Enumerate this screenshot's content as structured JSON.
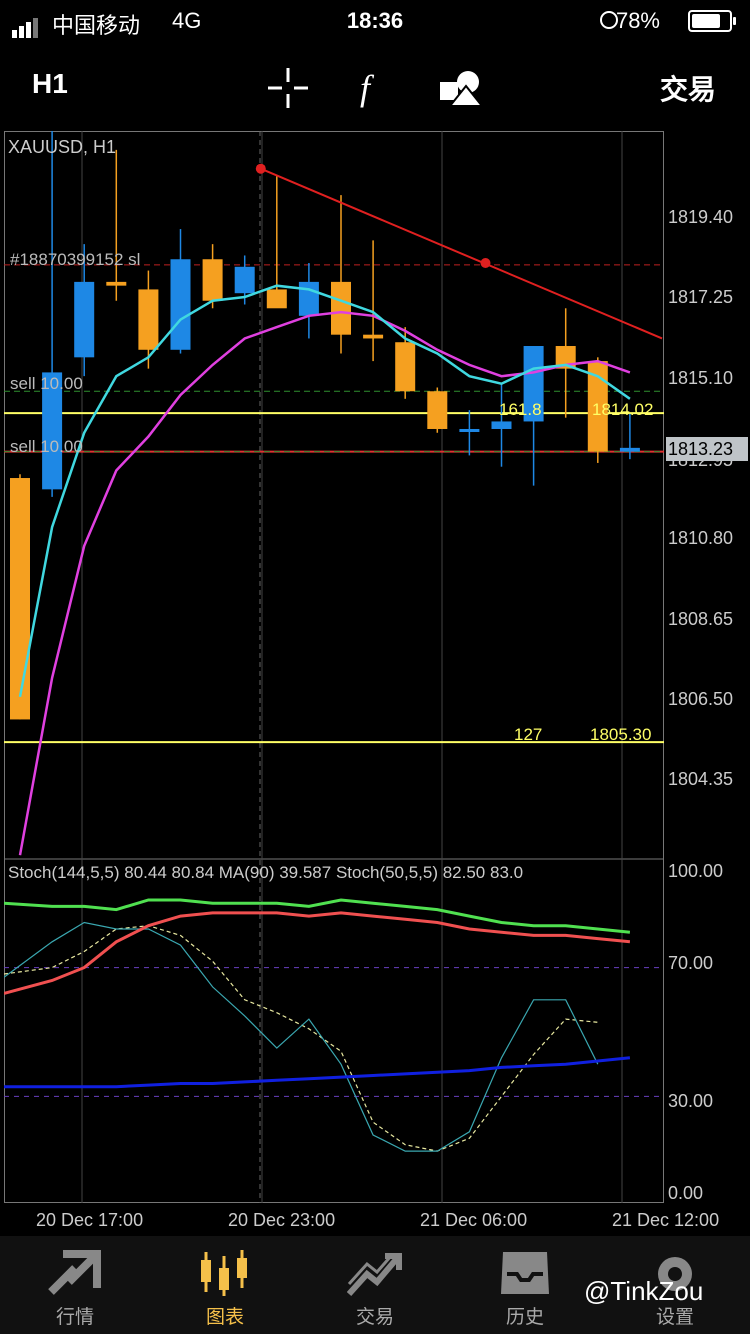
{
  "status_bar": {
    "carrier": "中国移动",
    "network": "4G",
    "time": "18:36",
    "battery": "78%"
  },
  "toolbar": {
    "timeframe": "H1",
    "trade_label": "交易",
    "icons": [
      "crosshair-icon",
      "function-icon",
      "objects-icon"
    ]
  },
  "chart": {
    "symbol_label": "XAUUSD, H1",
    "price_axis": [
      "1819.40",
      "1817.25",
      "1815.10",
      "1812.95",
      "1810.80",
      "1808.65",
      "1806.50",
      "1804.35"
    ],
    "current_price": "1813.23",
    "order_id_label": "#18870399152 sl",
    "orders": [
      {
        "label": "sell 10.00",
        "price": 1814.6
      },
      {
        "label": "sell 10.00",
        "price": 1813.0
      }
    ],
    "fib_levels": [
      {
        "ratio": "161.8",
        "price": "1814.02"
      },
      {
        "ratio": "127",
        "price": "1805.30"
      }
    ],
    "time_axis": [
      "20 Dec 17:00",
      "20 Dec 23:00",
      "21 Dec 06:00",
      "21 Dec 12:00"
    ],
    "ylim": [
      1802.2,
      1821.5
    ],
    "candles": [
      {
        "o": 1812.3,
        "h": 1812.4,
        "l": 1805.9,
        "c": 1805.9
      },
      {
        "o": 1812.0,
        "h": 1822.0,
        "l": 1811.8,
        "c": 1815.1
      },
      {
        "o": 1815.5,
        "h": 1818.5,
        "l": 1815.0,
        "c": 1817.5
      },
      {
        "o": 1817.5,
        "h": 1821.0,
        "l": 1817.0,
        "c": 1817.4
      },
      {
        "o": 1817.3,
        "h": 1817.8,
        "l": 1815.2,
        "c": 1815.7
      },
      {
        "o": 1815.7,
        "h": 1818.9,
        "l": 1815.6,
        "c": 1818.1
      },
      {
        "o": 1818.1,
        "h": 1818.5,
        "l": 1816.8,
        "c": 1817.0
      },
      {
        "o": 1817.2,
        "h": 1818.2,
        "l": 1816.9,
        "c": 1817.9
      },
      {
        "o": 1817.3,
        "h": 1820.3,
        "l": 1817.0,
        "c": 1816.8
      },
      {
        "o": 1816.6,
        "h": 1818.0,
        "l": 1816.0,
        "c": 1817.5
      },
      {
        "o": 1817.5,
        "h": 1819.8,
        "l": 1815.6,
        "c": 1816.1
      },
      {
        "o": 1816.1,
        "h": 1818.6,
        "l": 1815.4,
        "c": 1816.0
      },
      {
        "o": 1815.9,
        "h": 1816.3,
        "l": 1814.4,
        "c": 1814.6
      },
      {
        "o": 1814.6,
        "h": 1814.7,
        "l": 1813.5,
        "c": 1813.6
      },
      {
        "o": 1813.6,
        "h": 1814.1,
        "l": 1812.9,
        "c": 1813.6
      },
      {
        "o": 1813.6,
        "h": 1814.8,
        "l": 1812.6,
        "c": 1813.8
      },
      {
        "o": 1813.8,
        "h": 1815.8,
        "l": 1812.1,
        "c": 1815.8
      },
      {
        "o": 1815.8,
        "h": 1816.8,
        "l": 1813.9,
        "c": 1815.2
      },
      {
        "o": 1815.4,
        "h": 1815.5,
        "l": 1812.7,
        "c": 1813.0
      },
      {
        "o": 1813.0,
        "h": 1814.0,
        "l": 1812.8,
        "c": 1813.1
      }
    ],
    "ma_cyan": [
      1806.5,
      1811.0,
      1813.5,
      1815.0,
      1815.5,
      1816.5,
      1817.0,
      1817.1,
      1817.4,
      1817.3,
      1817.0,
      1816.7,
      1816.0,
      1815.6,
      1815.0,
      1814.8,
      1815.2,
      1815.3,
      1815.0,
      1814.4
    ],
    "ma_magenta": [
      1802.3,
      1807.0,
      1810.5,
      1812.5,
      1813.4,
      1814.5,
      1815.3,
      1816.0,
      1816.3,
      1816.6,
      1816.7,
      1816.6,
      1816.2,
      1815.7,
      1815.3,
      1815.0,
      1815.1,
      1815.3,
      1815.4,
      1815.1
    ],
    "trendline": [
      {
        "x": 8,
        "price": 1820.5
      },
      {
        "x": 15,
        "price": 1818.0
      },
      {
        "x": 20.5,
        "price": 1816.0
      }
    ],
    "horizontal_lines": [
      {
        "name": "yellow-level-high",
        "price": 1814.02,
        "color": "#ffff66"
      },
      {
        "name": "yellow-level-low",
        "price": 1805.3,
        "color": "#ffff66"
      },
      {
        "name": "red-sl-line",
        "price": 1813.0,
        "color": "#e03030"
      },
      {
        "name": "red-dashed-line",
        "price": 1817.95,
        "color": "#c02020"
      }
    ]
  },
  "stoch": {
    "label": "Stoch(144,5,5) 80.44 80.84 MA(90) 39.587 Stoch(50,5,5) 82.50 83.0",
    "axis": [
      "100.00",
      "70.00",
      "30.00",
      "0.00"
    ],
    "green": [
      90,
      89,
      89,
      88,
      91,
      91,
      90,
      90,
      90,
      89,
      91,
      90,
      89,
      88,
      86,
      84,
      83,
      83,
      82,
      81
    ],
    "red": [
      62,
      66,
      70,
      78,
      83,
      86,
      87,
      87,
      87,
      86,
      87,
      86,
      85,
      84,
      82,
      81,
      80,
      80,
      79,
      78
    ],
    "blue": [
      33,
      33,
      33,
      33,
      33.5,
      34,
      34,
      34.5,
      35,
      35.5,
      36,
      36.5,
      37,
      37.5,
      38,
      39,
      39.5,
      40,
      41,
      42
    ],
    "cyan_thin": [
      67,
      78,
      84,
      82,
      82,
      77,
      64,
      55,
      45,
      54,
      40,
      18,
      13,
      13,
      19,
      42,
      60,
      60,
      40
    ],
    "white_dashed": [
      68,
      70,
      75,
      82,
      83,
      80,
      72,
      60,
      56,
      51,
      44,
      22,
      15,
      13,
      17,
      30,
      43,
      54,
      53
    ]
  },
  "bottom_nav": [
    {
      "label": "行情",
      "icon": "quotes-icon",
      "active": false
    },
    {
      "label": "图表",
      "icon": "chart-icon",
      "active": true
    },
    {
      "label": "交易",
      "icon": "trade-icon",
      "active": false
    },
    {
      "label": "历史",
      "icon": "history-icon",
      "active": false
    },
    {
      "label": "设置",
      "icon": "settings-icon",
      "active": false
    }
  ],
  "watermark": "@TinkZou"
}
